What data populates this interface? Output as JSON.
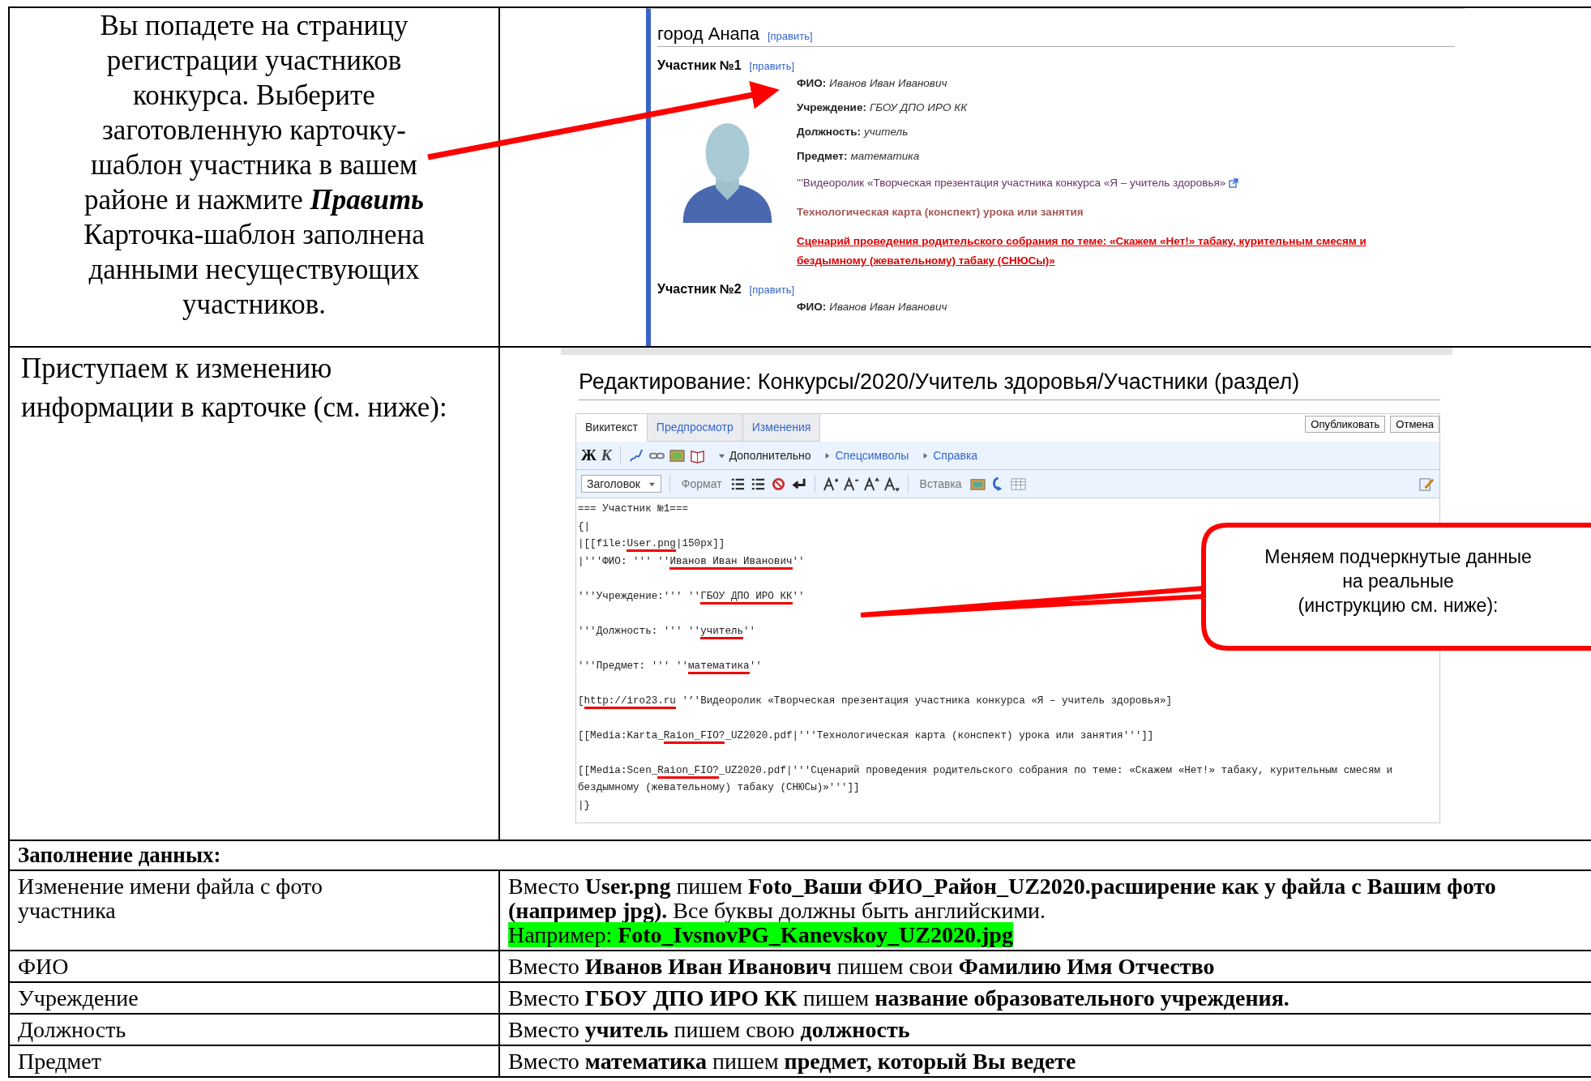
{
  "intro_row": {
    "paragraphs": [
      "Вы попадете на страницу регистрации участников конкурса. Выберите заготовленную карточку-шаблон участника в вашем районе и нажмите **Править**",
      "Карточка-шаблон заполнена данными несуществующих участников."
    ]
  },
  "wiki_page": {
    "heading": "город Анапа",
    "heading_edit": "[править]",
    "participants": [
      {
        "title": "Участник №1",
        "edit": "[править]",
        "fields": [
          {
            "label": "ФИО:",
            "value": "Иванов Иван Иванович"
          },
          {
            "label": "Учреждение:",
            "value": "ГБОУ ДПО ИРО КК"
          },
          {
            "label": "Должность:",
            "value": "учитель"
          },
          {
            "label": "Предмет:",
            "value": "математика"
          }
        ],
        "links": [
          {
            "kind": "external",
            "text": "'''Видеоролик «Творческая презентация участника конкурса «Я – учитель здоровья»"
          },
          {
            "kind": "file",
            "text": "Технологическая карта (конспект) урока или занятия"
          },
          {
            "kind": "missing",
            "text": "Сценарий проведения родительского собрания по теме: «Скажем «Нет!» табаку, курительным смесям и бездымному (жевательному) табаку (СНЮСы)»"
          }
        ]
      },
      {
        "title": "Участник №2",
        "edit": "[править]",
        "fields": [
          {
            "label": "ФИО:",
            "value": "Иванов Иван Иванович"
          }
        ]
      }
    ]
  },
  "edit_row": {
    "text": "Приступаем к изменению информации в карточке (см. ниже):"
  },
  "editor": {
    "title": "Редактирование: Конкурсы/2020/Учитель здоровья/Участники (раздел)",
    "tabs": [
      {
        "label": "Викитекст",
        "selected": true
      },
      {
        "label": "Предпросмотр",
        "selected": false
      },
      {
        "label": "Изменения",
        "selected": false
      }
    ],
    "buttons": [
      "Опубликовать",
      "Отмена"
    ],
    "bold_key": "Ж",
    "italic_key": "К",
    "menus": [
      {
        "label": "Дополнительно",
        "expanded": true
      },
      {
        "label": "Спецсимволы",
        "expanded": false
      },
      {
        "label": "Справка",
        "expanded": false
      }
    ],
    "heading_dropdown": "Заголовок",
    "format_label": "Формат",
    "insert_label": "Вставка",
    "code_lines": [
      {
        "blank_before": false,
        "parts": [
          {
            "text": "=== Участник №1===",
            "underlined": false
          }
        ]
      },
      {
        "blank_before": false,
        "parts": [
          {
            "text": "{|",
            "underlined": false
          }
        ]
      },
      {
        "blank_before": false,
        "parts": [
          {
            "text": "|[[file:",
            "underlined": false
          },
          {
            "text": "User.png",
            "underlined": true
          },
          {
            "text": "|150px]]",
            "underlined": false
          }
        ]
      },
      {
        "blank_before": false,
        "parts": [
          {
            "text": "|'''ФИО: ''' ''",
            "underlined": false
          },
          {
            "text": "Иванов Иван Иванович",
            "underlined": true
          },
          {
            "text": "''",
            "underlined": false
          }
        ]
      },
      {
        "blank_before": true,
        "parts": [
          {
            "text": "'''Учреждение:''' ''",
            "underlined": false
          },
          {
            "text": "ГБОУ ДПО ИРО КК",
            "underlined": true
          },
          {
            "text": "''",
            "underlined": false
          }
        ]
      },
      {
        "blank_before": true,
        "parts": [
          {
            "text": "'''Должность: ''' ''",
            "underlined": false
          },
          {
            "text": "учитель",
            "underlined": true
          },
          {
            "text": "''",
            "underlined": false
          }
        ]
      },
      {
        "blank_before": true,
        "parts": [
          {
            "text": "'''Предмет: ''' ''",
            "underlined": false
          },
          {
            "text": "математика",
            "underlined": true
          },
          {
            "text": "''",
            "underlined": false
          }
        ]
      },
      {
        "blank_before": true,
        "parts": [
          {
            "text": "[",
            "underlined": false
          },
          {
            "text": "http://iro23.ru",
            "underlined": true
          },
          {
            "text": " '’'Видеоролик «Творческая презентация участника конкурса «Я – учитель здоровья»]",
            "underlined": false
          }
        ]
      },
      {
        "blank_before": true,
        "parts": [
          {
            "text": "[[Media:Karta_",
            "underlined": false
          },
          {
            "text": "Raion_FIO?",
            "underlined": true
          },
          {
            "text": "_UZ2020.pdf|'''Технологическая карта (конспект) урока или занятия''']]",
            "underlined": false
          }
        ]
      },
      {
        "blank_before": true,
        "parts": [
          {
            "text": "[[Media:Scen_",
            "underlined": false
          },
          {
            "text": "Raion_FIO?",
            "underlined": true
          },
          {
            "text": "_UZ2020.pdf|'''Сценарий проведения родительского собрания по теме: «Скажем «Нет!» табаку, курительным смесям и",
            "underlined": false
          }
        ]
      },
      {
        "blank_before": false,
        "parts": [
          {
            "text": "бездымному (жевательному) табаку (СНЮСы)»''']]",
            "underlined": false
          }
        ]
      },
      {
        "blank_before": false,
        "parts": [
          {
            "text": "|}",
            "underlined": false
          }
        ]
      }
    ]
  },
  "callout": {
    "lines": [
      "Меняем подчеркнутые данные на реальные",
      "(инструкцию см. ниже):"
    ]
  },
  "fill_table": {
    "heading": "Заполнение данных:",
    "rows": [
      {
        "label": "Изменение имени файла с фото участника",
        "description": "Вместо **User.png** пишем **Foto_Ваши ФИО_Район_UZ2020.расширение как у файла с Вашим фото (например jpg).** Все буквы должны быть английскими.",
        "example": "Например: **Foto_IvsnovPG_Kanevskoy_UZ2020.jpg**"
      },
      {
        "label": "ФИО",
        "description": "Вместо **Иванов Иван Иванович** пишем свои **Фамилию Имя Отчество**"
      },
      {
        "label": "Учреждение",
        "description": "Вместо **ГБОУ ДПО ИРО КК** пишем **название образовательного учреждения.**"
      },
      {
        "label": "Должность",
        "description": "Вместо **учитель** пишем свою **должность**"
      },
      {
        "label": "Предмет",
        "description": "Вместо **математика** пишем **предмет, который Вы ведете**"
      }
    ]
  }
}
